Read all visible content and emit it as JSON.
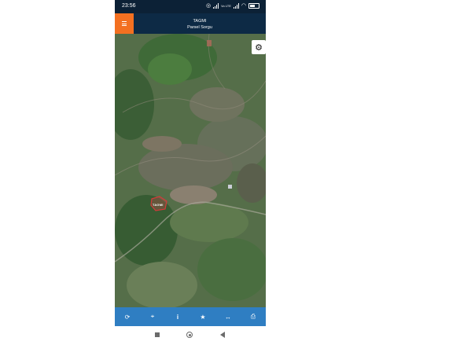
{
  "status_bar": {
    "time": "23:56",
    "network_label": "Vo LTE"
  },
  "header": {
    "title": "TAGMI",
    "subtitle": "Parsel Sorgu"
  },
  "map": {
    "parcel_label": "TAGMI",
    "buttons": {
      "settings_icon": "gear-icon"
    }
  },
  "toolbar": {
    "items": [
      {
        "name": "refresh",
        "icon": "refresh-icon",
        "glyph": "⟳"
      },
      {
        "name": "locate",
        "icon": "crosshair-icon",
        "glyph": "⌖"
      },
      {
        "name": "info",
        "icon": "info-icon",
        "glyph": "i"
      },
      {
        "name": "favorite",
        "icon": "star-icon",
        "glyph": "★"
      },
      {
        "name": "measure",
        "icon": "ruler-icon",
        "glyph": "↔"
      },
      {
        "name": "print",
        "icon": "print-icon",
        "glyph": "⎙"
      }
    ]
  },
  "colors": {
    "status_bar": "#0c2136",
    "header": "#0d2a45",
    "menu_accent": "#f37021",
    "toolbar": "#2f7ec2",
    "parcel_outline": "#d23a3a"
  }
}
